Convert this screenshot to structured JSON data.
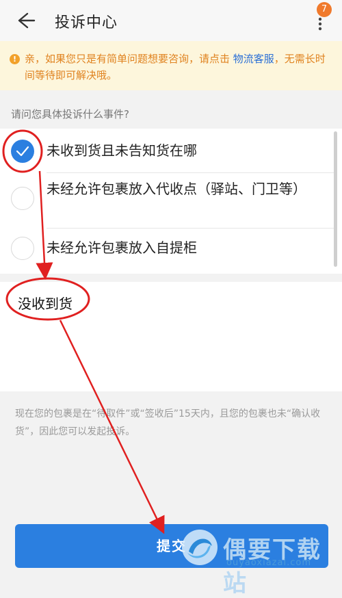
{
  "header": {
    "title": "投诉中心",
    "badge_count": "7"
  },
  "notice": {
    "text_before": "亲，如果您只是有简单问题想要咨询，请点击 ",
    "link": "物流客服",
    "text_after": "，无需长时间等待即可解决哦。"
  },
  "question": "请问您具体投诉什么事件?",
  "options": [
    {
      "label": "未收到货且未告知货在哪",
      "checked": true
    },
    {
      "label": "未经允许包裹放入代收点（驿站、门卫等）",
      "checked": false
    },
    {
      "label": "未经允许包裹放入自提柜",
      "checked": false
    }
  ],
  "textarea": {
    "value": "没收到货"
  },
  "hint": "现在您的包裹是在“待取件”或“签收后”15天内，且您的包裹也未“确认收货”，因此您可以发起投诉。",
  "submit_label": "提交",
  "watermark": {
    "brand": "偶要下载站",
    "url": "ouyaoxiazai.com"
  },
  "colors": {
    "accent": "#2b7fe0",
    "annotation": "#e02020",
    "notice_text": "#e08320",
    "notice_bg": "#fdf6dc"
  }
}
